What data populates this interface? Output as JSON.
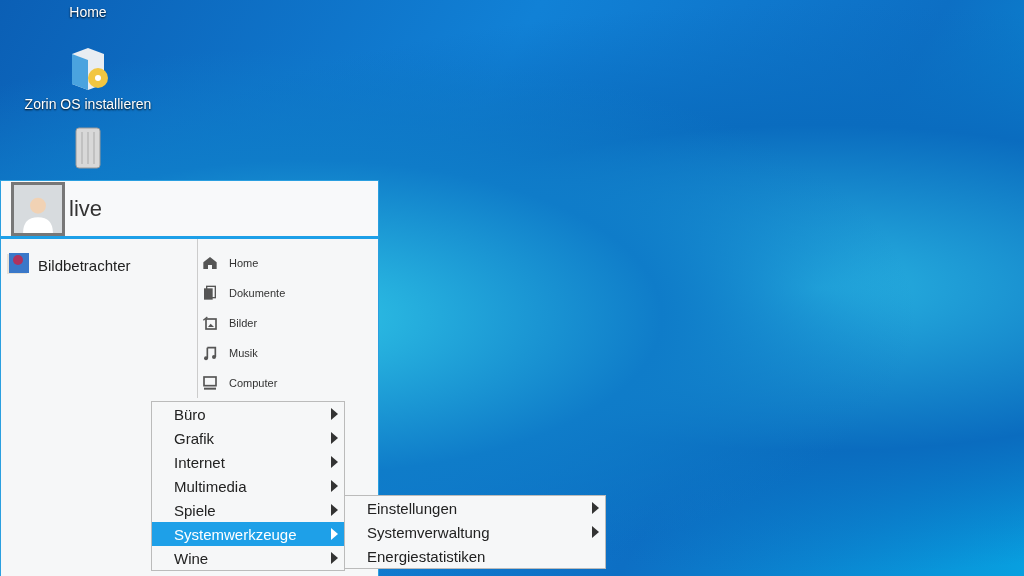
{
  "desktop_icons": [
    {
      "kind": "home",
      "label": "Home"
    },
    {
      "kind": "installer",
      "label": "Zorin OS installieren"
    },
    {
      "kind": "trash"
    }
  ],
  "start_menu": {
    "user": "live",
    "recent_apps": [
      {
        "kind": "image-viewer",
        "label": "Bildbetrachter"
      }
    ],
    "places": [
      {
        "kind": "home",
        "label": "Home"
      },
      {
        "kind": "documents",
        "label": "Dokumente"
      },
      {
        "kind": "pictures",
        "label": "Bilder"
      },
      {
        "kind": "music",
        "label": "Musik"
      },
      {
        "kind": "computer",
        "label": "Computer"
      }
    ]
  },
  "categories_menu": [
    {
      "label": "Büro",
      "submenu": true,
      "selected": false
    },
    {
      "label": "Grafik",
      "submenu": true,
      "selected": false
    },
    {
      "label": "Internet",
      "submenu": true,
      "selected": false
    },
    {
      "label": "Multimedia",
      "submenu": true,
      "selected": false
    },
    {
      "label": "Spiele",
      "submenu": true,
      "selected": false
    },
    {
      "label": "Systemwerkzeuge",
      "submenu": true,
      "selected": true
    },
    {
      "label": "Wine",
      "submenu": true,
      "selected": false
    }
  ],
  "system_tools_menu": [
    {
      "label": "Einstellungen",
      "submenu": true
    },
    {
      "label": "Systemverwaltung",
      "submenu": true
    },
    {
      "label": "Energiestatistiken",
      "submenu": false
    }
  ]
}
